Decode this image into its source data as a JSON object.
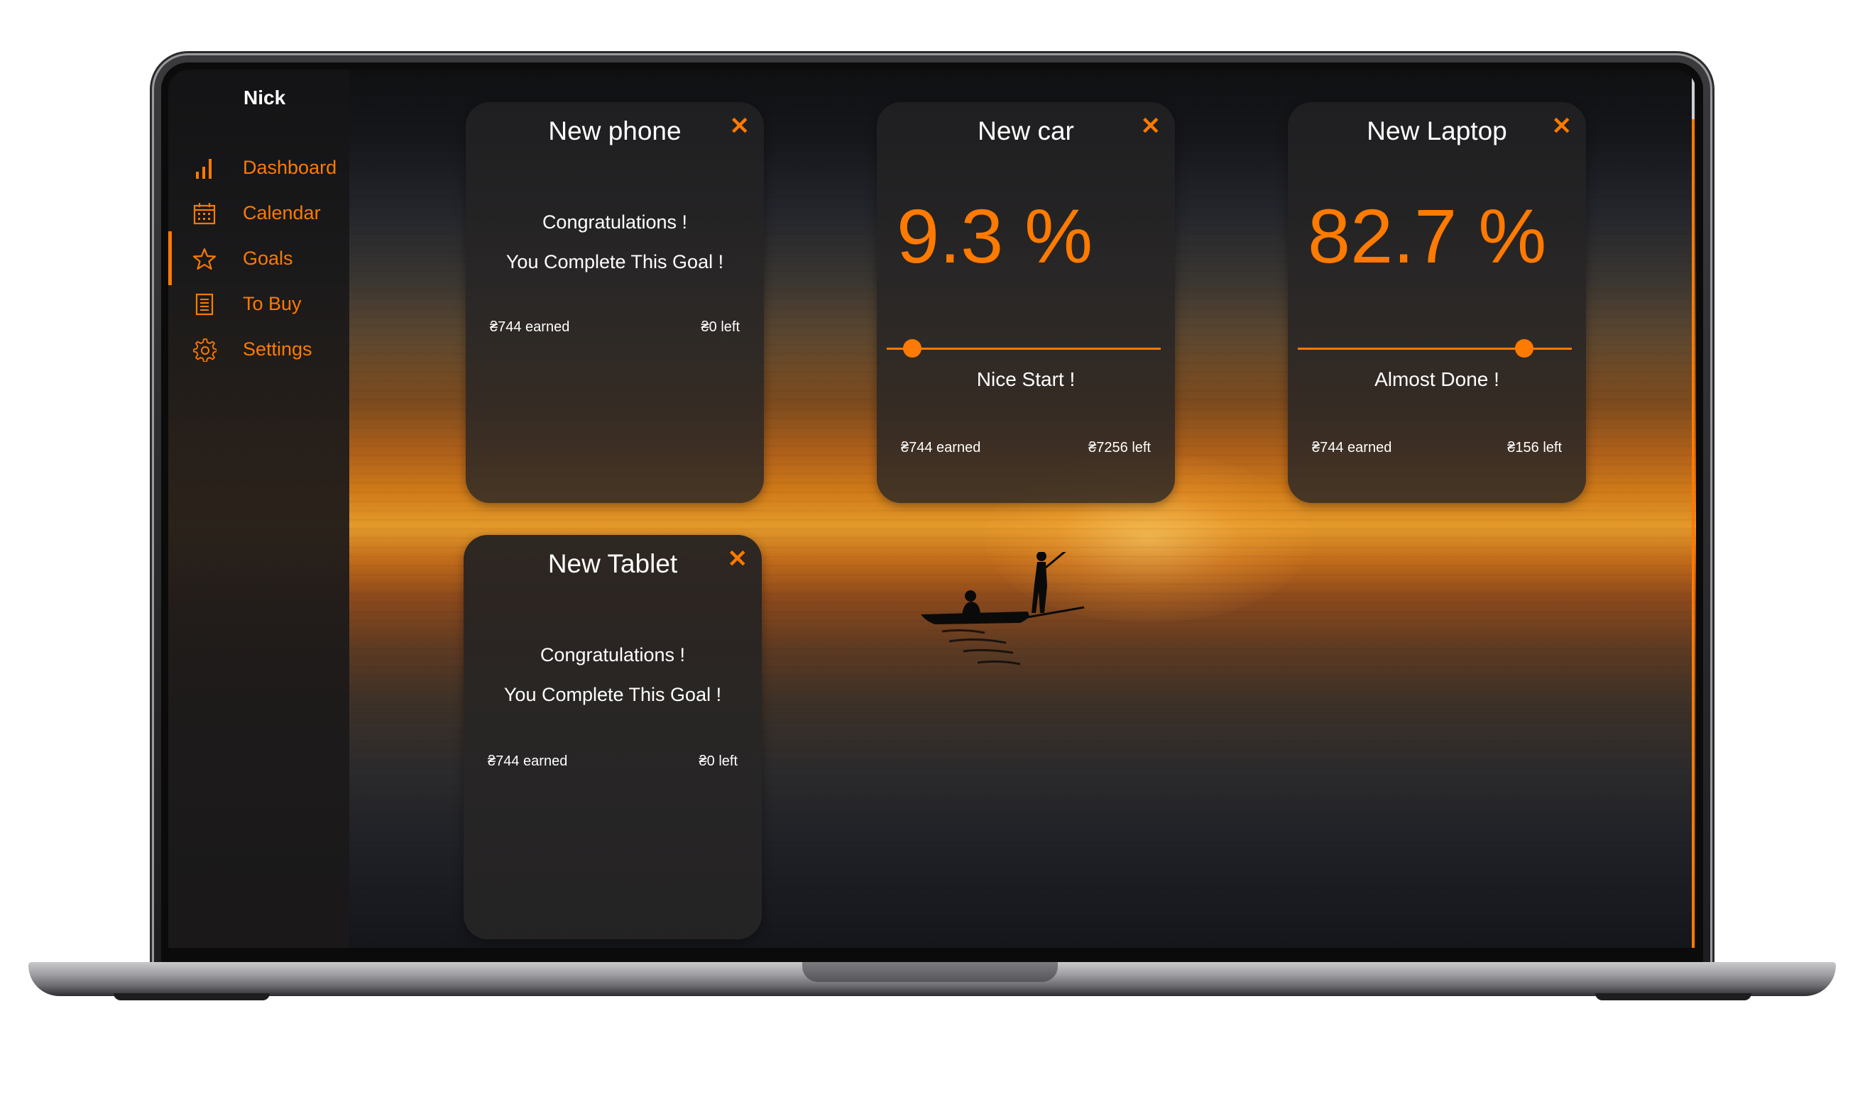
{
  "user": {
    "name": "Nick"
  },
  "sidebar": {
    "items": [
      {
        "label": "Dashboard",
        "icon": "bar-chart-icon",
        "active": false
      },
      {
        "label": "Calendar",
        "icon": "calendar-icon",
        "active": false
      },
      {
        "label": "Goals",
        "icon": "star-icon",
        "active": true
      },
      {
        "label": "To Buy",
        "icon": "list-icon",
        "active": false
      },
      {
        "label": "Settings",
        "icon": "gear-icon",
        "active": false
      }
    ]
  },
  "goals": [
    {
      "title": "New phone",
      "completed": true,
      "message_1": "Congratulations !",
      "message_2": "You Complete This Goal !",
      "earned": "₴744 earned",
      "left": "₴0 left"
    },
    {
      "title": "New car",
      "completed": false,
      "percent": "9.3 %",
      "progress": 0.093,
      "status": "Nice Start !",
      "earned": "₴744 earned",
      "left": "₴7256 left"
    },
    {
      "title": "New Laptop",
      "completed": false,
      "percent": "82.7 %",
      "progress": 0.827,
      "status": "Almost Done !",
      "earned": "₴744 earned",
      "left": "₴156 left"
    },
    {
      "title": "New Tablet",
      "completed": true,
      "message_1": "Congratulations !",
      "message_2": "You Complete This Goal !",
      "earned": "₴744 earned",
      "left": "₴0 left"
    }
  ],
  "ui": {
    "close_glyph": "✕",
    "accent_color": "#ff7a00"
  }
}
